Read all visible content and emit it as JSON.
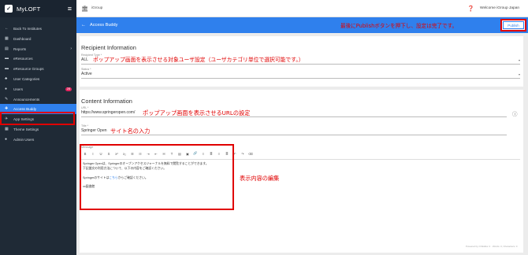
{
  "sidebar": {
    "brand": "MyLOFT",
    "menu_icon": "menu-icon",
    "items": [
      {
        "label": "Back To Institutes",
        "icon": "arrow-left-icon",
        "glyph": "←"
      },
      {
        "label": "Dashboard",
        "icon": "dashboard-icon",
        "glyph": "▦"
      },
      {
        "label": "Reports",
        "icon": "reports-icon",
        "glyph": "▤",
        "chevron": "›"
      },
      {
        "label": "eResources",
        "icon": "eresources-icon",
        "glyph": "▬"
      },
      {
        "label": "eResource Groups",
        "icon": "eresource-groups-icon",
        "glyph": "▬"
      },
      {
        "label": "User Categories",
        "icon": "user-categories-icon",
        "glyph": "♣"
      },
      {
        "label": "Users",
        "icon": "users-icon",
        "glyph": "●",
        "badge": "28"
      },
      {
        "label": "Announcements",
        "icon": "announcements-icon",
        "glyph": "✎"
      },
      {
        "label": "Access Buddy",
        "icon": "access-buddy-icon",
        "glyph": "✚",
        "active": true
      },
      {
        "label": "App Settings",
        "icon": "app-settings-icon",
        "glyph": "✈"
      },
      {
        "label": "Theme Settings",
        "icon": "theme-settings-icon",
        "glyph": "▦"
      },
      {
        "label": "Admin Users",
        "icon": "admin-users-icon",
        "glyph": "●"
      }
    ]
  },
  "topbar": {
    "group": "iGroup",
    "welcome": "Welcome iGroup Japan",
    "help_icon": "help-icon"
  },
  "header": {
    "back_glyph": "←",
    "title": "Access Buddy",
    "publish_label": "Publish",
    "annotation": "最後にPublishボタンを押下し、設定は完了です。"
  },
  "recipient": {
    "heading": "Recipient Information",
    "user_category_label": "Recipient Type *",
    "user_category_value": "ALL",
    "user_category_annotation": "ポップアップ画面を表示させる対象ユーザ設定（ユーザカテゴリ単位で選択可能です。）",
    "status_label": "Status *",
    "status_value": "Active"
  },
  "content": {
    "heading": "Content Information",
    "url_label": "URL *",
    "url_value": "https://www.springeropen.com/",
    "url_annotation": "ポップアップ画面を表示させるURLの設定",
    "title_label": "Title *",
    "title_value": "Springer Open",
    "title_annotation": "サイト名の入力",
    "message_label": "Message",
    "message_annotation": "表示内容の編集",
    "toolbar": [
      "B",
      "I",
      "U",
      "S",
      "x²",
      "x₂",
      "☰",
      "☷",
      "⇥",
      "⇤",
      "H",
      "T",
      "▤",
      "▣",
      "🔗",
      "≡",
      "≣",
      "≡",
      "≣",
      "↶",
      "↷",
      "⌫"
    ],
    "message_lines": [
      "Springer Openは、Springerのオープンアクセスジャーナルを無料で閲覧することができます。",
      "下記論文の利用方法について、以下の内容をご確認ください。"
    ],
    "link_prefix": "Springerのサイトは",
    "link_text": "こちら",
    "link_suffix": "からご確認ください。",
    "signature": "xx図書館",
    "status_text": "Powered by CKEditor 4 · Words: 0, Characters: 0"
  },
  "colors": {
    "sidebar_bg": "#1f2a36",
    "accent": "#2f80ed",
    "annotation": "#e00000"
  }
}
